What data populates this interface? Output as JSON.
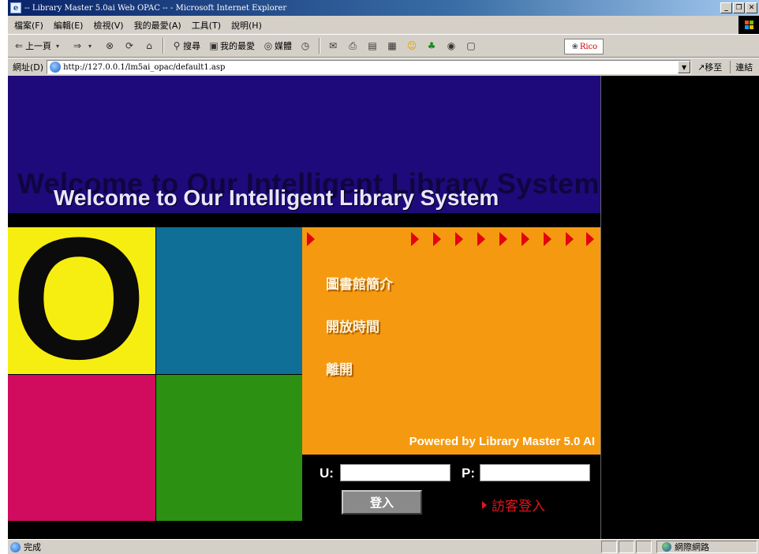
{
  "window": {
    "title": "-- Library Master 5.0ai Web OPAC -- - Microsoft Internet Explorer",
    "controls": [
      "_",
      "❐",
      "✕"
    ]
  },
  "menu": [
    "檔案(F)",
    "編輯(E)",
    "檢視(V)",
    "我的最愛(A)",
    "工具(T)",
    "說明(H)"
  ],
  "toolbar": {
    "back": "上一頁",
    "search": "搜尋",
    "favorites": "我的最愛",
    "media": "媒體",
    "rico": "Rico"
  },
  "address": {
    "label": "網址(D)",
    "url": "http://127.0.0.1/lm5ai_opac/default1.asp",
    "go": "移至",
    "links": "連結"
  },
  "page": {
    "banner_shadow": "Welcome to Our Intelligent Library System",
    "banner_title": "Welcome to Our Intelligent Library System",
    "big_letter": "O",
    "nav": [
      "圖書館簡介",
      "開放時間",
      "離開"
    ],
    "powered_by": "Powered by Library Master 5.0 AI",
    "login": {
      "user_label": "U:",
      "pass_label": "P:",
      "submit": "登入",
      "guest": "訪客登入"
    }
  },
  "colors": {
    "banner": "#1e0a7a",
    "yellow": "#f7ee11",
    "teal": "#0f6f96",
    "pink": "#d10b5e",
    "green": "#2c9012",
    "orange": "#f59a10",
    "arrow": "#e3000f"
  },
  "status": {
    "text": "完成",
    "zone": "網際網路"
  }
}
